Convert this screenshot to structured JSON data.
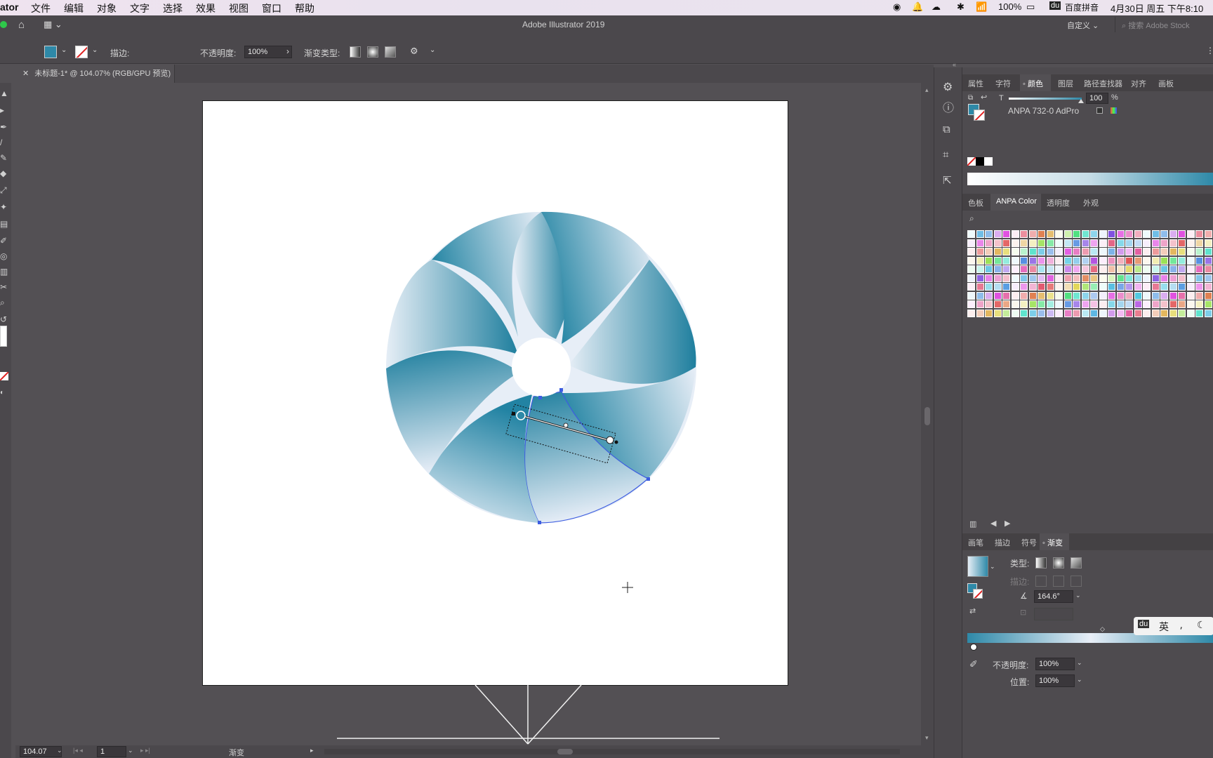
{
  "menubar": {
    "app": "ator",
    "items": [
      "文件",
      "编辑",
      "对象",
      "文字",
      "选择",
      "效果",
      "视图",
      "窗口",
      "帮助"
    ],
    "battery": "100%",
    "ime": "百度拼音",
    "datetime": "4月30日 周五 下午8:10"
  },
  "appbar": {
    "title": "Adobe Illustrator 2019",
    "workspace": "自定义",
    "search_placeholder": "搜索 Adobe Stock"
  },
  "control": {
    "stroke_label": "描边:",
    "opacity_label": "不透明度:",
    "opacity_value": "100%",
    "gradient_type_label": "渐变类型:"
  },
  "document": {
    "tab_title": "未标题-1* @ 104.07% (RGB/GPU 预览)"
  },
  "status": {
    "zoom": "104.07",
    "artboard": "1",
    "tool": "渐变"
  },
  "color_panel": {
    "tabs": [
      "属性",
      "字符",
      "颜色",
      "图层",
      "路径查找器",
      "对齐",
      "画板"
    ],
    "active_tab": "颜色",
    "tint_label": "T",
    "tint_value": "100",
    "tint_unit": "%",
    "swatch_name": "ANPA 732-0 AdPro",
    "fill_color": "#2e89a8"
  },
  "swatch_panel": {
    "tabs": [
      "色板",
      "ANPA Color",
      "透明度",
      "外观"
    ],
    "active_tab": "ANPA Color"
  },
  "gradient_panel": {
    "tabs": [
      "画笔",
      "描边",
      "符号",
      "渐变"
    ],
    "active_tab": "渐变",
    "type_label": "类型:",
    "stroke_label": "描边:",
    "angle": "164.6°",
    "opacity_label": "不透明度:",
    "opacity_value": "100%",
    "location_label": "位置:",
    "location_value": "100%",
    "ime_label": "英"
  },
  "colors": {
    "accent": "#2e89a8",
    "dark_blue": "#1f7f9e",
    "light_blue": "#e8eef7"
  }
}
